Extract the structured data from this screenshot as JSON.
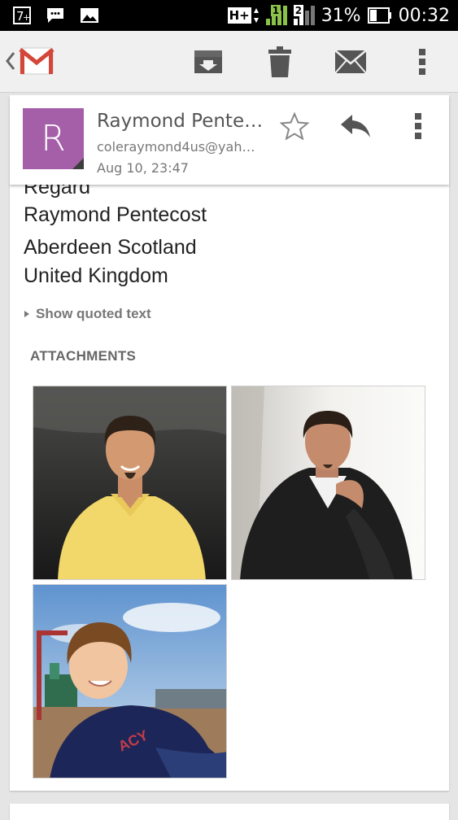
{
  "status_bar": {
    "network_type": "H+",
    "sim1_label": "1",
    "sim2_label": "2",
    "battery": "31%",
    "time": "00:32"
  },
  "action_bar": {
    "app_icon": "gmail-icon",
    "actions": [
      "archive",
      "delete",
      "mark-unread",
      "more"
    ]
  },
  "message_header": {
    "avatar_letter": "R",
    "avatar_color": "#a55fa8",
    "sender_name": "Raymond Pente…",
    "sender_email": "coleraymond4us@yah…",
    "date": "Aug 10, 23:47"
  },
  "message_body": {
    "lines": [
      "Regard",
      "Raymond Pentecost",
      "Aberdeen Scotland",
      "United Kingdom"
    ],
    "show_quoted_label": "Show quoted text",
    "attachments_heading": "ATTACHMENTS",
    "attachments": [
      {
        "name": "man-yellow-shirt-photo"
      },
      {
        "name": "man-leather-jacket-photo"
      },
      {
        "name": "boy-navy-sweater-photo"
      }
    ]
  }
}
